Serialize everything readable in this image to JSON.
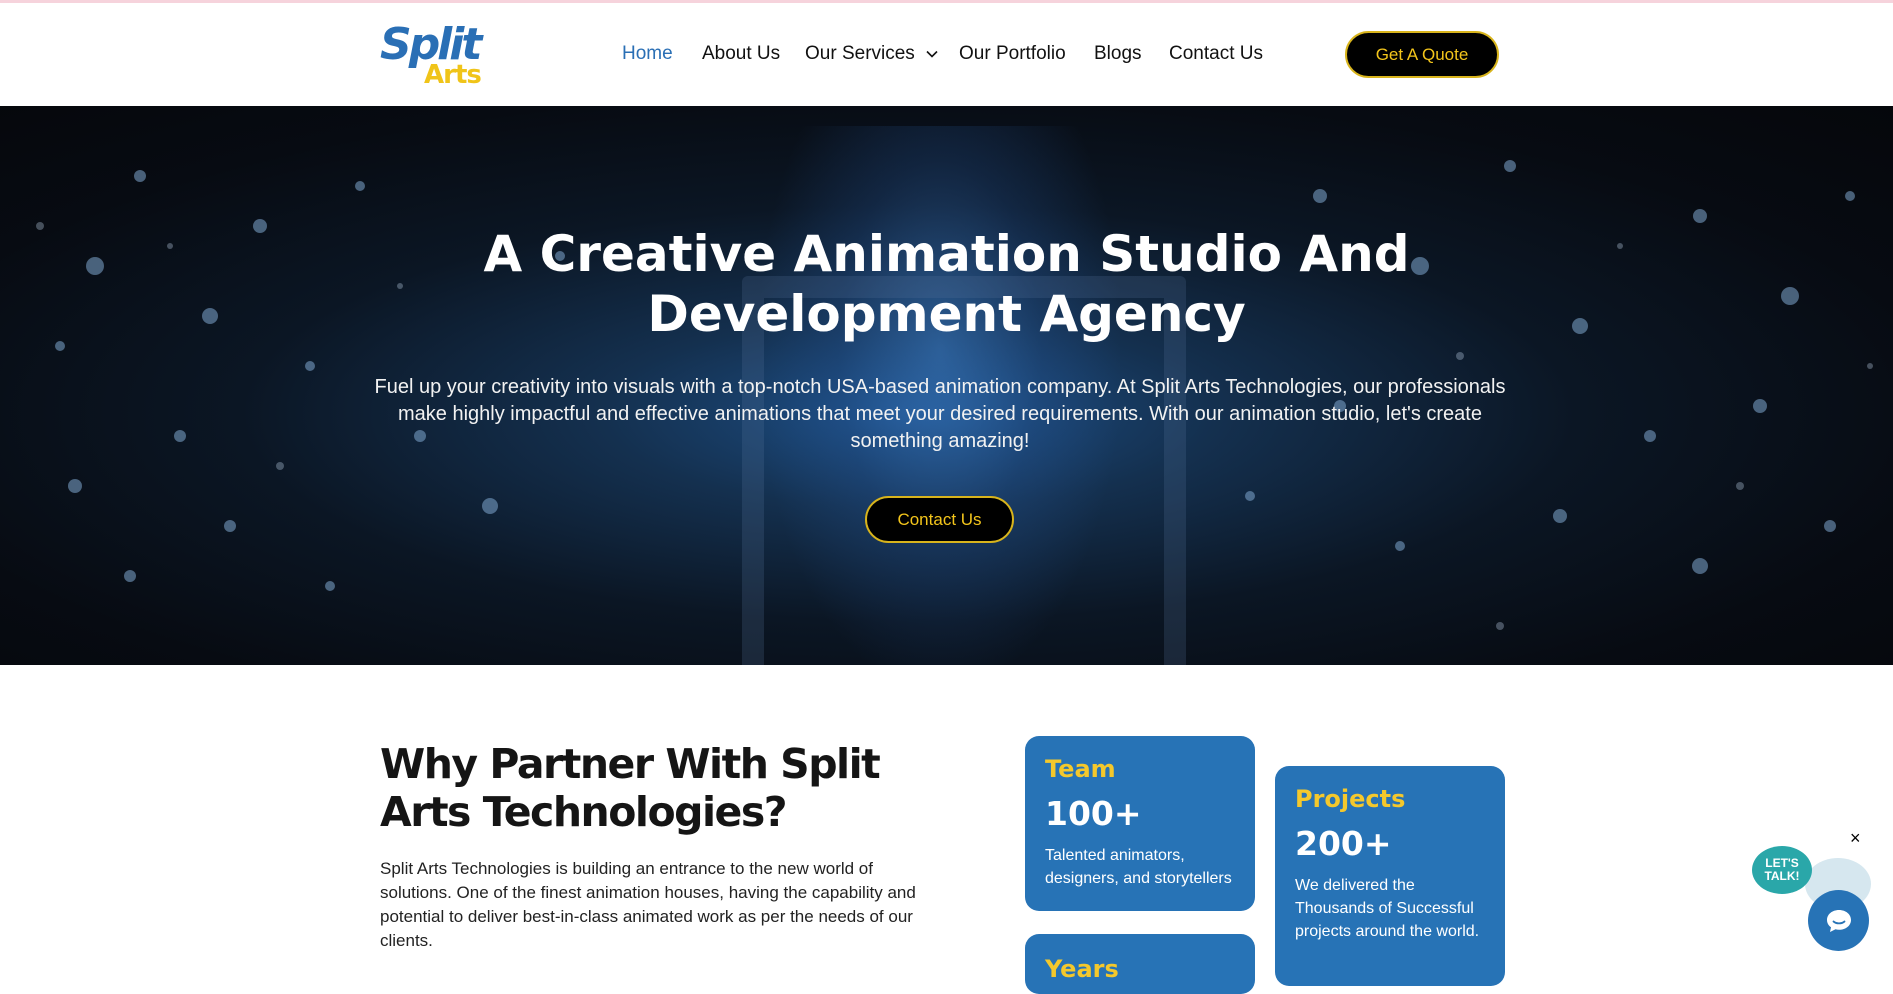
{
  "brand": {
    "logo_top": "Split",
    "logo_bottom": "Arts",
    "primary": "#2773b6",
    "accent": "#f3c51b"
  },
  "nav": {
    "items": [
      {
        "label": "Home",
        "active": true
      },
      {
        "label": "About Us"
      },
      {
        "label": "Our Services",
        "has_dropdown": true
      },
      {
        "label": "Our Portfolio"
      },
      {
        "label": "Blogs"
      },
      {
        "label": "Contact Us"
      }
    ],
    "cta": "Get A Quote"
  },
  "hero": {
    "title_line1": "A Creative Animation Studio And",
    "title_line2": "Development Agency",
    "description": "Fuel up your creativity into visuals with a top-notch USA-based animation company. At Split Arts Technologies, our professionals make highly impactful and effective animations that meet your desired requirements. With our animation studio, let's create something amazing!",
    "button": "Contact Us"
  },
  "why": {
    "title": "Why Partner With Split Arts Technologies?",
    "description": "Split Arts Technologies is building an entrance to the new world of solutions. One of the finest animation houses, having the capability and potential to deliver best-in-class animated work as per the needs of our clients."
  },
  "stats": [
    {
      "label": "Team",
      "number": "100+",
      "text": "Talented animators, designers, and storytellers"
    },
    {
      "label": "Projects",
      "number": "200+",
      "text": "We delivered the Thousands of Successful projects around the world."
    },
    {
      "label": "Years",
      "number": "",
      "text": ""
    }
  ],
  "chat": {
    "bubble": "LET'S TALK!",
    "close": "×"
  }
}
